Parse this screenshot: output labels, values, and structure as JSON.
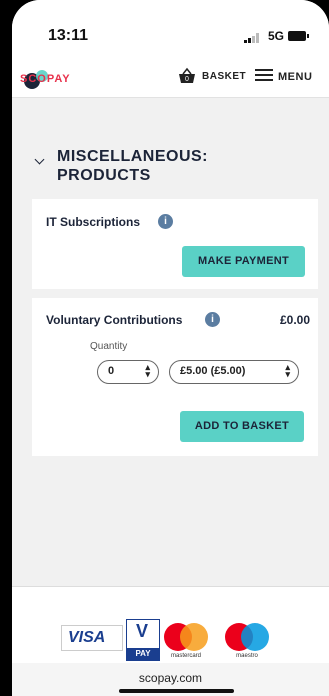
{
  "status_bar": {
    "time": "13:11",
    "network": "5G"
  },
  "header": {
    "logo_text": "SCOPAY",
    "basket_label": "BASKET",
    "basket_count": "0",
    "menu_label": "MENU"
  },
  "section": {
    "title_line1": "MISCELLANEOUS:",
    "title_line2": "PRODUCTS"
  },
  "items": [
    {
      "label": "IT Subscriptions",
      "button_label": "MAKE PAYMENT"
    },
    {
      "label": "Voluntary Contributions",
      "price": "£0.00",
      "quantity_label": "Quantity",
      "quantity_value": "0",
      "amount_value": "£5.00 (£5.00)",
      "button_label": "ADD TO BASKET"
    }
  ],
  "footer": {
    "visa_label": "VISA",
    "vpay_v": "V",
    "vpay_label": "PAY",
    "mastercard_label": "mastercard",
    "maestro_label": "maestro",
    "url": "scopay.com"
  },
  "colors": {
    "accent": "#5ad1c6",
    "brand": "#e8314b",
    "navy": "#1c2438"
  }
}
